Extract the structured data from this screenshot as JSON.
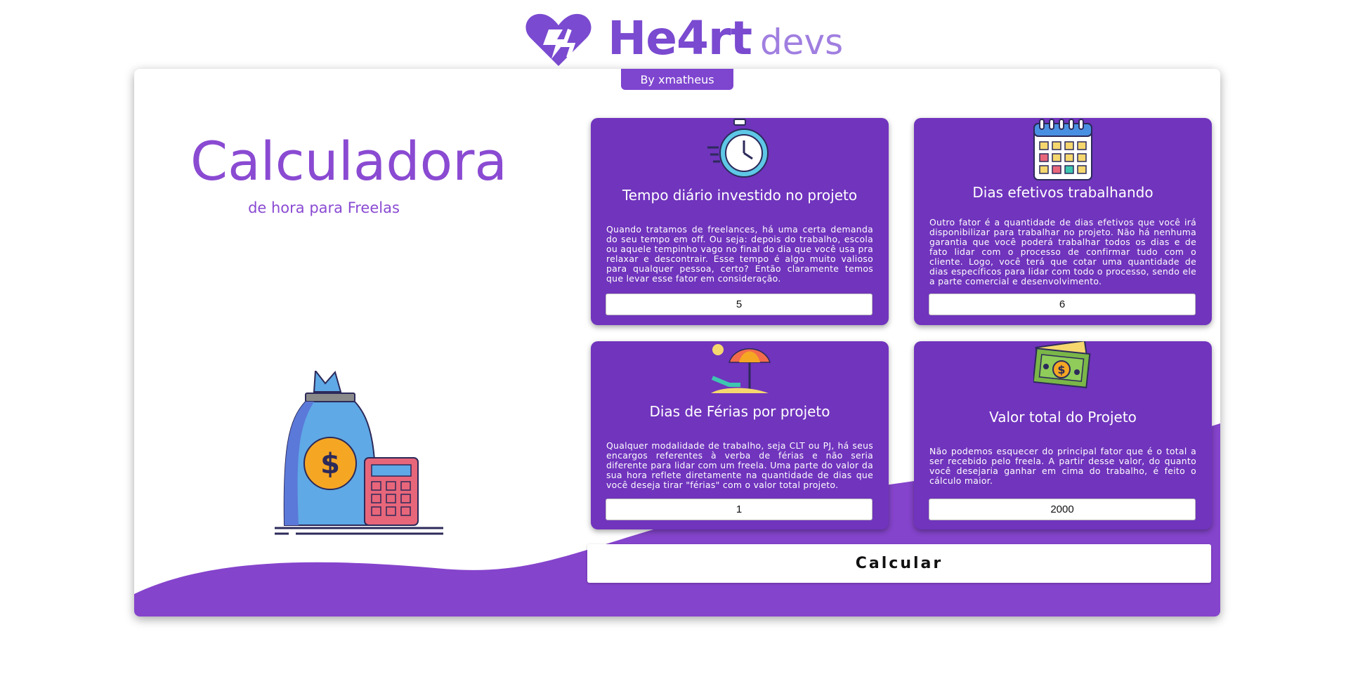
{
  "logo": {
    "main": "He4rt",
    "sub": "devs",
    "brand_color": "#7a4ad0"
  },
  "author_tab": "By xmatheus",
  "hero": {
    "title": "Calculadora",
    "subtitle": "de hora para Freelas"
  },
  "fields": [
    {
      "icon": "stopwatch-icon",
      "title": "Tempo diário investido no projeto",
      "description": "Quando tratamos de freelances, há uma certa demanda do seu tempo em off. Ou seja: depois do trabalho, escola ou aquele tempinho vago no final do dia que você usa pra relaxar e descontrair. Esse tempo é algo muito valioso para qualquer pessoa, certo? Então claramente temos que levar esse fator em consideração.",
      "value": "5"
    },
    {
      "icon": "calendar-icon",
      "title": "Dias efetivos trabalhando",
      "description": "Outro fator é a quantidade de dias efetivos que você irá disponibilizar para trabalhar no projeto. Não há nenhuma garantia que você poderá trabalhar todos os dias e de fato lidar com o processo de confirmar tudo com o cliente. Logo, você terá que cotar uma quantidade de dias específicos para lidar com todo o processo, sendo ele a parte comercial e desenvolvimento.",
      "value": "6"
    },
    {
      "icon": "beach-umbrella-icon",
      "title": "Dias de Férias por projeto",
      "description": "Qualquer modalidade de trabalho, seja CLT ou PJ, há seus encargos referentes à verba de férias e não seria diferente para lidar com um freela. Uma parte do valor da sua hora reflete diretamente na quantidade de dias que você deseja tirar \"férias\" com o valor total projeto.",
      "value": "1"
    },
    {
      "icon": "money-bills-icon",
      "title": "Valor total do Projeto",
      "description": "Não podemos esquecer do principal fator que é o total a ser recebido pelo freela. A partir desse valor, do quanto você desejaria ganhar em cima do trabalho, é feito o cálculo maior.",
      "value": "2000"
    }
  ],
  "calculate_button": "Calcular",
  "colors": {
    "accent": "#7034bd",
    "wave": "#8544cc",
    "title": "#8a4ad2"
  }
}
